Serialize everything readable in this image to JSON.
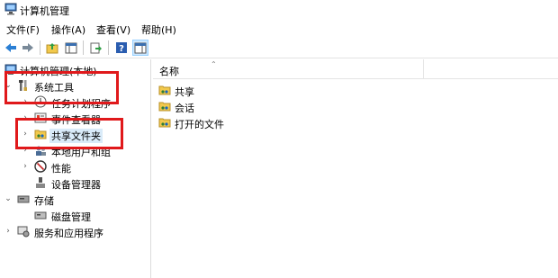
{
  "window": {
    "title": "计算机管理"
  },
  "menu": [
    "文件(F)",
    "操作(A)",
    "查看(V)",
    "帮助(H)"
  ],
  "toolbar": {
    "buttons": [
      "back-icon",
      "forward-icon",
      "up-folder-icon",
      "show-hide-tree-icon",
      "export-icon",
      "help-icon",
      "properties-icon"
    ]
  },
  "tree": {
    "root": "计算机管理(本地)",
    "system_tools": "系统工具",
    "task_scheduler": "任务计划程序",
    "event_viewer": "事件查看器",
    "shared_folders": "共享文件夹",
    "local_users": "本地用户和组",
    "performance": "性能",
    "device_manager": "设备管理器",
    "storage": "存储",
    "disk_management": "磁盘管理",
    "services_apps": "服务和应用程序"
  },
  "content": {
    "column_name": "名称",
    "items": [
      "共享",
      "会话",
      "打开的文件"
    ]
  },
  "colors": {
    "highlight": "#e0191b",
    "selection": "#d9ebf9"
  }
}
